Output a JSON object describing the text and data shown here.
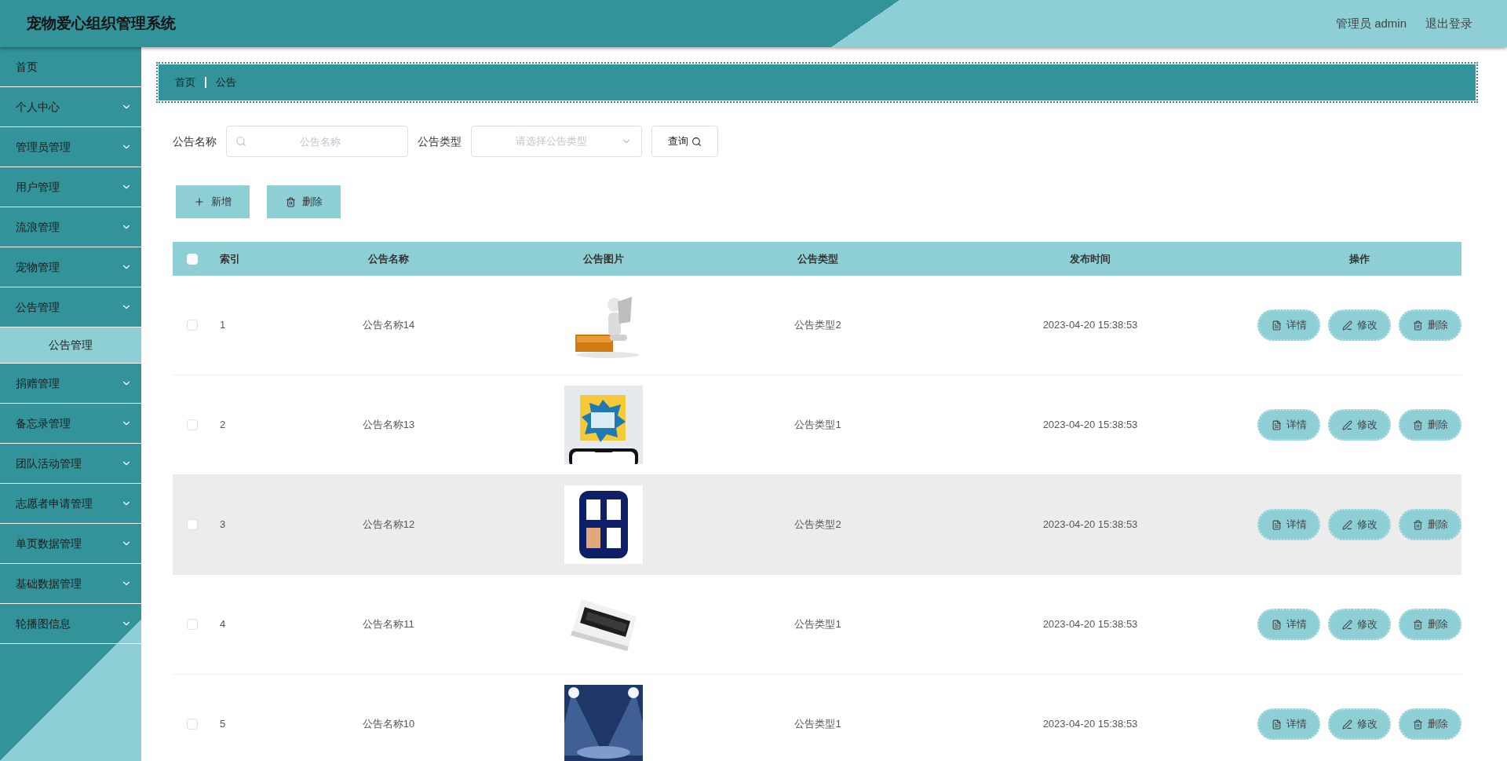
{
  "header": {
    "title": "宠物爱心组织管理系统",
    "user": "管理员 admin",
    "logout": "退出登录"
  },
  "sidebar": {
    "items": [
      {
        "label": "首页",
        "kind": "link",
        "selected": false
      },
      {
        "label": "个人中心",
        "kind": "submenu",
        "selected": false
      },
      {
        "label": "管理员管理",
        "kind": "submenu",
        "selected": false
      },
      {
        "label": "用户管理",
        "kind": "submenu",
        "selected": false
      },
      {
        "label": "流浪管理",
        "kind": "submenu",
        "selected": false
      },
      {
        "label": "宠物管理",
        "kind": "submenu",
        "selected": false
      },
      {
        "label": "公告管理",
        "kind": "submenu",
        "selected": false,
        "children": [
          {
            "label": "公告管理",
            "selected": true
          }
        ]
      },
      {
        "label": "捐赠管理",
        "kind": "submenu",
        "selected": false
      },
      {
        "label": "备忘录管理",
        "kind": "submenu",
        "selected": false
      },
      {
        "label": "团队活动管理",
        "kind": "submenu",
        "selected": false
      },
      {
        "label": "志愿者申请管理",
        "kind": "submenu",
        "selected": false
      },
      {
        "label": "单页数据管理",
        "kind": "submenu",
        "selected": false
      },
      {
        "label": "基础数据管理",
        "kind": "submenu",
        "selected": false
      },
      {
        "label": "轮播图信息",
        "kind": "submenu",
        "selected": false
      }
    ]
  },
  "breadcrumb": [
    "首页",
    "公告"
  ],
  "search": {
    "name_label": "公告名称",
    "name_placeholder": "公告名称",
    "type_label": "公告类型",
    "type_placeholder": "请选择公告类型",
    "query_button": "查询"
  },
  "actions": {
    "add": "新增",
    "delete": "删除"
  },
  "table": {
    "columns": [
      "索引",
      "公告名称",
      "公告图片",
      "公告类型",
      "发布时间",
      "操作"
    ],
    "header_checked": false,
    "rows": [
      {
        "index": "1",
        "name": "公告名称14",
        "type": "公告类型2",
        "time": "2023-04-20 15:38:53",
        "checked": false,
        "hovered": false,
        "buttons": [
          "详情",
          "修改",
          "删除"
        ]
      },
      {
        "index": "2",
        "name": "公告名称13",
        "type": "公告类型1",
        "time": "2023-04-20 15:38:53",
        "checked": false,
        "hovered": false,
        "buttons": [
          "详情",
          "修改",
          "删除"
        ]
      },
      {
        "index": "3",
        "name": "公告名称12",
        "type": "公告类型2",
        "time": "2023-04-20 15:38:53",
        "checked": false,
        "hovered": true,
        "buttons": [
          "详情",
          "修改",
          "删除"
        ]
      },
      {
        "index": "4",
        "name": "公告名称11",
        "type": "公告类型1",
        "time": "2023-04-20 15:38:53",
        "checked": false,
        "hovered": false,
        "buttons": [
          "详情",
          "修改",
          "删除"
        ]
      },
      {
        "index": "5",
        "name": "公告名称10",
        "type": "公告类型1",
        "time": "2023-04-20 15:38:53",
        "checked": false,
        "hovered": false,
        "buttons": [
          "详情",
          "修改",
          "删除"
        ]
      }
    ]
  }
}
